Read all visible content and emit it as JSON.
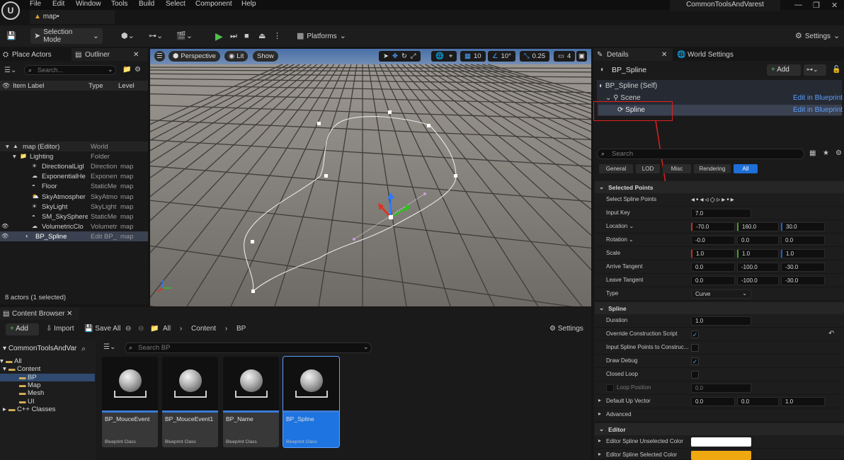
{
  "menu": {
    "items": [
      "File",
      "Edit",
      "Window",
      "Tools",
      "Build",
      "Select",
      "Component",
      "Help"
    ]
  },
  "tab": {
    "title": "map•"
  },
  "project": {
    "name": "CommonToolsAndVarest"
  },
  "toolbar": {
    "selection_mode": "Selection Mode",
    "platforms": "Platforms",
    "settings": "Settings"
  },
  "left_tabs": {
    "place_actors": "Place Actors",
    "outliner": "Outliner"
  },
  "outliner": {
    "search_placeholder": "Search...",
    "columns": [
      "Item Label",
      "Type",
      "Level"
    ],
    "rows": [
      {
        "label": "map (Editor)",
        "type": "World",
        "level": ""
      },
      {
        "label": "Lighting",
        "type": "Folder",
        "level": ""
      },
      {
        "label": "DirectionalLigl",
        "type": "Direction",
        "level": "map"
      },
      {
        "label": "ExponentialHe",
        "type": "Exponent",
        "level": "map"
      },
      {
        "label": "Floor",
        "type": "StaticMe",
        "level": "map"
      },
      {
        "label": "SkyAtmospher",
        "type": "SkyAtmo",
        "level": "map"
      },
      {
        "label": "SkyLight",
        "type": "SkyLight",
        "level": "map"
      },
      {
        "label": "SM_SkySphere",
        "type": "StaticMe",
        "level": "map"
      },
      {
        "label": "VolumetricClo",
        "type": "Volumetr",
        "level": "map"
      },
      {
        "label": "BP_Spline",
        "type": "Edit BP_S",
        "level": "map"
      }
    ],
    "status": "8 actors (1 selected)"
  },
  "viewport": {
    "perspective": "Perspective",
    "lit": "Lit",
    "show": "Show",
    "grid_size": "10",
    "rot_snap": "10°",
    "scale_snap": "0.25",
    "camera_speed": "4"
  },
  "details": {
    "tab": "Details",
    "world_settings_tab": "World Settings",
    "actor_name": "BP_Spline",
    "add_label": "Add",
    "tree": [
      {
        "label": "BP_Spline (Self)",
        "action": ""
      },
      {
        "label": "Scene",
        "action": "Edit in Blueprint"
      },
      {
        "label": "Spline",
        "action": "Edit in Blueprint"
      }
    ],
    "search_placeholder": "Search",
    "filters": [
      "General",
      "LOD",
      "Misc",
      "Rendering",
      "All"
    ],
    "sections": {
      "selected_points": "Selected Points",
      "spline": "Spline",
      "advanced": "Advanced",
      "editor": "Editor"
    },
    "props": {
      "select_points": "Select Spline Points",
      "input_key": {
        "label": "Input Key",
        "value": "7.0"
      },
      "location": {
        "label": "Location",
        "x": "-70.0",
        "y": "160.0",
        "z": "30.0"
      },
      "rotation": {
        "label": "Rotation",
        "x": "-0.0",
        "y": "0.0",
        "z": "0.0"
      },
      "scale": {
        "label": "Scale",
        "x": "1.0",
        "y": "1.0",
        "z": "1.0"
      },
      "arrive": {
        "label": "Arrive Tangent",
        "x": "0.0",
        "y": "-100.0",
        "z": "-30.0"
      },
      "leave": {
        "label": "Leave Tangent",
        "x": "0.0",
        "y": "-100.0",
        "z": "-30.0"
      },
      "type": {
        "label": "Type",
        "value": "Curve"
      },
      "duration": {
        "label": "Duration",
        "value": "1.0"
      },
      "override": {
        "label": "Override Construction Script"
      },
      "input_points": {
        "label": "Input Spline Points to Construc..."
      },
      "draw_debug": {
        "label": "Draw Debug"
      },
      "closed_loop": {
        "label": "Closed Loop"
      },
      "loop_position": {
        "label": "Loop Position",
        "value": "0.0"
      },
      "up_vector": {
        "label": "Default Up Vector",
        "x": "0.0",
        "y": "0.0",
        "z": "1.0"
      },
      "unselected_color": {
        "label": "Editor Spline Unselected Color",
        "color": "#ffffff"
      },
      "selected_color": {
        "label": "Editor Spline Selected Color",
        "color": "#f0a810"
      }
    }
  },
  "content_browser": {
    "tab": "Content Browser",
    "add": "Add",
    "import": "Import",
    "save_all": "Save All",
    "breadcrumb": [
      "All",
      "Content",
      "BP"
    ],
    "settings": "Settings",
    "search_placeholder": "Search BP",
    "tree_root": "CommonToolsAndVar",
    "tree": [
      "All",
      "Content",
      "BP",
      "Map",
      "Mesh",
      "UI",
      "C++ Classes"
    ],
    "assets": [
      {
        "name": "BP_MouceEvent",
        "class": "Blueprint Class"
      },
      {
        "name": "BP_MouceEvent1",
        "class": "Blueprint Class"
      },
      {
        "name": "BP_Name",
        "class": "Blueprint Class"
      },
      {
        "name": "BP_Spline",
        "class": "Blueprint Class"
      }
    ]
  }
}
